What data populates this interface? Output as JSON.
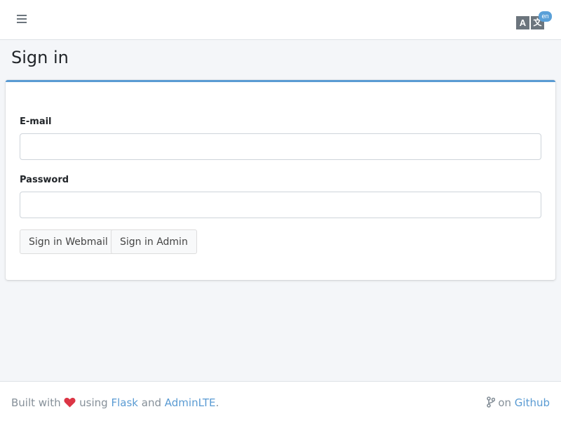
{
  "header": {
    "menu_icon": "hamburger-menu-icon",
    "language": {
      "icon": "translate-icon",
      "badge": "en"
    }
  },
  "page": {
    "title": "Sign in"
  },
  "form": {
    "email_label": "E-mail",
    "email_value": "",
    "password_label": "Password",
    "password_value": "",
    "buttons": {
      "webmail": "Sign in Webmail",
      "admin": "Sign in Admin"
    }
  },
  "footer": {
    "built_with": "Built with",
    "heart_icon": "heart-icon",
    "using": "using",
    "flask_link": "Flask",
    "and": "and",
    "adminlte_link": "AdminLTE",
    "period": ".",
    "branch_icon": "code-branch-icon",
    "on": "on",
    "github_link": "Github"
  },
  "colors": {
    "accent": "#5a9bd3",
    "heart": "#dc3545",
    "background": "#f4f6f9"
  }
}
